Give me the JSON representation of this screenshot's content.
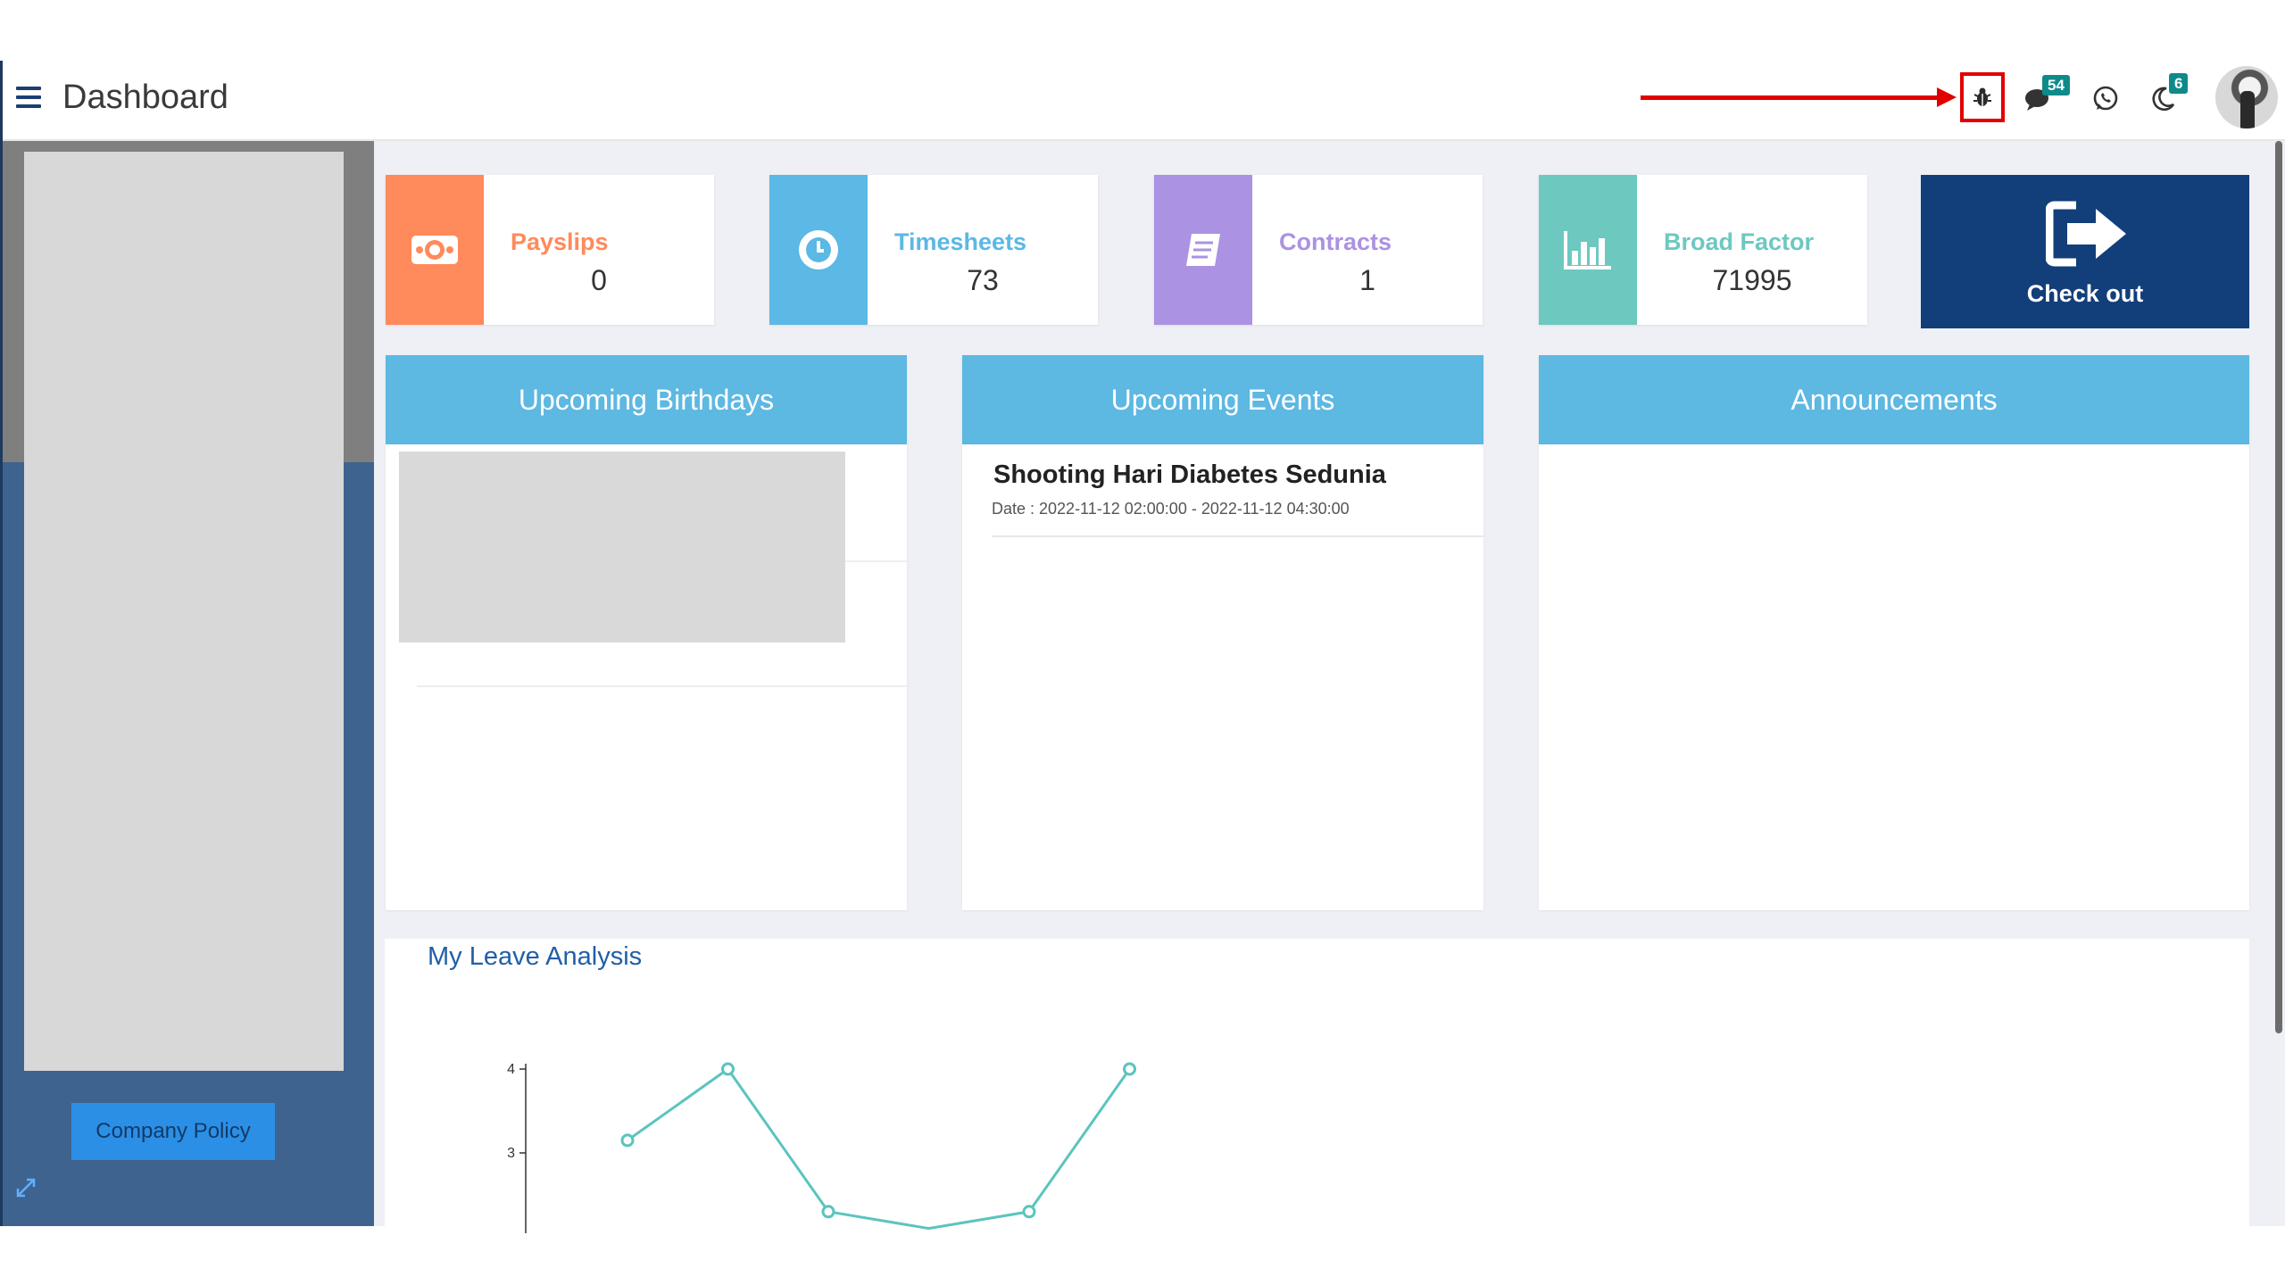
{
  "header": {
    "title": "Dashboard",
    "messages_badge": "54",
    "notifications_badge": "6",
    "icons": [
      "menu-icon",
      "bug-icon",
      "chat-icon",
      "whatsapp-icon",
      "moon-icon"
    ]
  },
  "sidebar": {
    "policy_label": "Company Policy"
  },
  "cards": [
    {
      "label": "Payslips",
      "value": "0",
      "color": "#ff8a5b",
      "icon": "money-icon"
    },
    {
      "label": "Timesheets",
      "value": "73",
      "color": "#5cb8e4",
      "icon": "clock-icon"
    },
    {
      "label": "Contracts",
      "value": "1",
      "color": "#ab92e2",
      "icon": "document-icon"
    },
    {
      "label": "Broad Factor",
      "value": "71995",
      "color": "#6dc8c0",
      "icon": "bar-chart-icon"
    }
  ],
  "checkout": {
    "label": "Check out",
    "color": "#123e7a"
  },
  "panels": {
    "birthdays": {
      "title": "Upcoming Birthdays"
    },
    "events": {
      "title": "Upcoming Events",
      "items": [
        {
          "title": "Shooting Hari Diabetes Sedunia",
          "date": "Date : 2022-11-12 02:00:00 - 2022-11-12 04:30:00"
        }
      ]
    },
    "announcements": {
      "title": "Announcements"
    }
  },
  "analysis": {
    "title": "My Leave Analysis"
  },
  "chart_data": {
    "type": "line",
    "x": [
      1,
      2,
      3,
      4,
      5,
      6
    ],
    "values": [
      3.15,
      4,
      2.3,
      2.1,
      2.3,
      4
    ],
    "yticks": [
      3,
      4
    ],
    "ylim": [
      2,
      4.2
    ],
    "color": "#5bc4be"
  },
  "accent": "#5db8e2"
}
